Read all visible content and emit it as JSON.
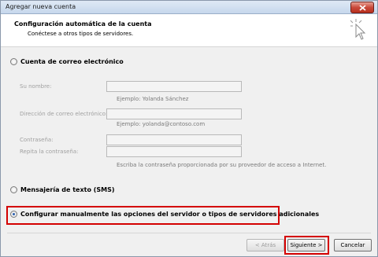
{
  "window": {
    "title": "Agregar nueva cuenta"
  },
  "header": {
    "title": "Configuración automática de la cuenta",
    "subtitle": "Conéctese a otros tipos de servidores."
  },
  "options": {
    "email": "Cuenta de correo electrónico",
    "sms": "Mensajería de texto (SMS)",
    "manual": "Configurar manualmente las opciones del servidor o tipos de servidores adicionales"
  },
  "form": {
    "name_label": "Su nombre:",
    "name_hint": "Ejemplo: Yolanda Sánchez",
    "email_label": "Dirección de correo electrónico:",
    "email_hint": "Ejemplo: yolanda@contoso.com",
    "password_label": "Contraseña:",
    "repeat_label": "Repita la contraseña:",
    "password_hint": "Escriba la contraseña proporcionada por su proveedor de acceso a Internet."
  },
  "buttons": {
    "back": "< Atrás",
    "next": "Siguiente >",
    "cancel": "Cancelar"
  }
}
